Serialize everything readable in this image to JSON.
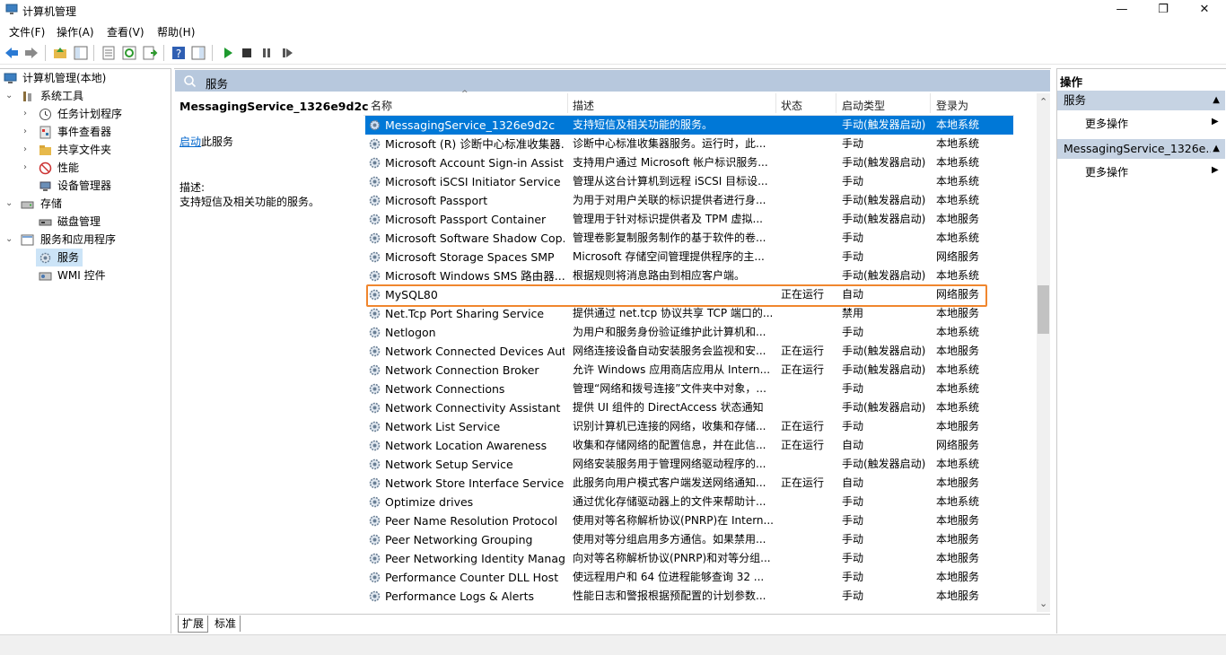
{
  "window": {
    "title": "计算机管理",
    "minimize": "—",
    "maximize": "❐",
    "close": "✕"
  },
  "menu": [
    "文件(F)",
    "操作(A)",
    "查看(V)",
    "帮助(H)"
  ],
  "tree": {
    "root": "计算机管理(本地)",
    "system_tools": "系统工具",
    "task_scheduler": "任务计划程序",
    "event_viewer": "事件查看器",
    "shared_folders": "共享文件夹",
    "performance": "性能",
    "device_manager": "设备管理器",
    "storage": "存储",
    "disk_management": "磁盘管理",
    "services_apps": "服务和应用程序",
    "services": "服务",
    "wmi": "WMI 控件"
  },
  "center": {
    "header": "服务",
    "selected_name": "MessagingService_1326e9d2c",
    "start_link": "启动",
    "start_suffix": "此服务",
    "desc_label": "描述:",
    "desc_text": "支持短信及相关功能的服务。"
  },
  "columns": {
    "name": "名称",
    "desc": "描述",
    "status": "状态",
    "startup": "启动类型",
    "logon": "登录为"
  },
  "services": [
    {
      "name": "MessagingService_1326e9d2c",
      "desc": "支持短信及相关功能的服务。",
      "status": "",
      "startup": "手动(触发器启动)",
      "logon": "本地系统"
    },
    {
      "name": "Microsoft (R) 诊断中心标准收集器...",
      "desc": "诊断中心标准收集器服务。运行时，此...",
      "status": "",
      "startup": "手动",
      "logon": "本地系统"
    },
    {
      "name": "Microsoft Account Sign-in Assist...",
      "desc": "支持用户通过 Microsoft 帐户标识服务...",
      "status": "",
      "startup": "手动(触发器启动)",
      "logon": "本地系统"
    },
    {
      "name": "Microsoft iSCSI Initiator Service",
      "desc": "管理从这台计算机到远程 iSCSI 目标设...",
      "status": "",
      "startup": "手动",
      "logon": "本地系统"
    },
    {
      "name": "Microsoft Passport",
      "desc": "为用于对用户关联的标识提供者进行身...",
      "status": "",
      "startup": "手动(触发器启动)",
      "logon": "本地系统"
    },
    {
      "name": "Microsoft Passport Container",
      "desc": "管理用于针对标识提供者及 TPM 虚拟...",
      "status": "",
      "startup": "手动(触发器启动)",
      "logon": "本地服务"
    },
    {
      "name": "Microsoft Software Shadow Cop...",
      "desc": "管理卷影复制服务制作的基于软件的卷...",
      "status": "",
      "startup": "手动",
      "logon": "本地系统"
    },
    {
      "name": "Microsoft Storage Spaces SMP",
      "desc": "Microsoft 存储空间管理提供程序的主...",
      "status": "",
      "startup": "手动",
      "logon": "网络服务"
    },
    {
      "name": "Microsoft Windows SMS 路由器...",
      "desc": "根据规则将消息路由到相应客户端。",
      "status": "",
      "startup": "手动(触发器启动)",
      "logon": "本地系统"
    },
    {
      "name": "MySQL80",
      "desc": "",
      "status": "正在运行",
      "startup": "自动",
      "logon": "网络服务"
    },
    {
      "name": "Net.Tcp Port Sharing Service",
      "desc": "提供通过 net.tcp 协议共享 TCP 端口的...",
      "status": "",
      "startup": "禁用",
      "logon": "本地服务"
    },
    {
      "name": "Netlogon",
      "desc": "为用户和服务身份验证维护此计算机和...",
      "status": "",
      "startup": "手动",
      "logon": "本地系统"
    },
    {
      "name": "Network Connected Devices Aut...",
      "desc": "网络连接设备自动安装服务会监视和安...",
      "status": "正在运行",
      "startup": "手动(触发器启动)",
      "logon": "本地服务"
    },
    {
      "name": "Network Connection Broker",
      "desc": "允许 Windows 应用商店应用从 Intern...",
      "status": "正在运行",
      "startup": "手动(触发器启动)",
      "logon": "本地系统"
    },
    {
      "name": "Network Connections",
      "desc": "管理“网络和拨号连接”文件夹中对象，...",
      "status": "",
      "startup": "手动",
      "logon": "本地系统"
    },
    {
      "name": "Network Connectivity Assistant",
      "desc": "提供 UI 组件的 DirectAccess 状态通知",
      "status": "",
      "startup": "手动(触发器启动)",
      "logon": "本地系统"
    },
    {
      "name": "Network List Service",
      "desc": "识别计算机已连接的网络，收集和存储...",
      "status": "正在运行",
      "startup": "手动",
      "logon": "本地服务"
    },
    {
      "name": "Network Location Awareness",
      "desc": "收集和存储网络的配置信息，并在此信...",
      "status": "正在运行",
      "startup": "自动",
      "logon": "网络服务"
    },
    {
      "name": "Network Setup Service",
      "desc": "网络安装服务用于管理网络驱动程序的...",
      "status": "",
      "startup": "手动(触发器启动)",
      "logon": "本地系统"
    },
    {
      "name": "Network Store Interface Service",
      "desc": "此服务向用户模式客户端发送网络通知...",
      "status": "正在运行",
      "startup": "自动",
      "logon": "本地服务"
    },
    {
      "name": "Optimize drives",
      "desc": "通过优化存储驱动器上的文件来帮助计...",
      "status": "",
      "startup": "手动",
      "logon": "本地系统"
    },
    {
      "name": "Peer Name Resolution Protocol",
      "desc": "使用对等名称解析协议(PNRP)在 Intern...",
      "status": "",
      "startup": "手动",
      "logon": "本地服务"
    },
    {
      "name": "Peer Networking Grouping",
      "desc": "使用对等分组启用多方通信。如果禁用...",
      "status": "",
      "startup": "手动",
      "logon": "本地服务"
    },
    {
      "name": "Peer Networking Identity Manag...",
      "desc": "向对等名称解析协议(PNRP)和对等分组...",
      "status": "",
      "startup": "手动",
      "logon": "本地服务"
    },
    {
      "name": "Performance Counter DLL Host",
      "desc": "使远程用户和 64 位进程能够查询 32 ...",
      "status": "",
      "startup": "手动",
      "logon": "本地服务"
    },
    {
      "name": "Performance Logs & Alerts",
      "desc": "性能日志和警报根据预配置的计划参数...",
      "status": "",
      "startup": "手动",
      "logon": "本地服务"
    }
  ],
  "tabs": [
    "扩展",
    "标准"
  ],
  "actions": {
    "title": "操作",
    "section1": "服务",
    "more1": "更多操作",
    "section2": "MessagingService_1326e...",
    "more2": "更多操作"
  },
  "colors": {
    "selected_row": "#0078d7",
    "highlight_box": "#f0862e",
    "section_header": "#b7c8dd"
  }
}
